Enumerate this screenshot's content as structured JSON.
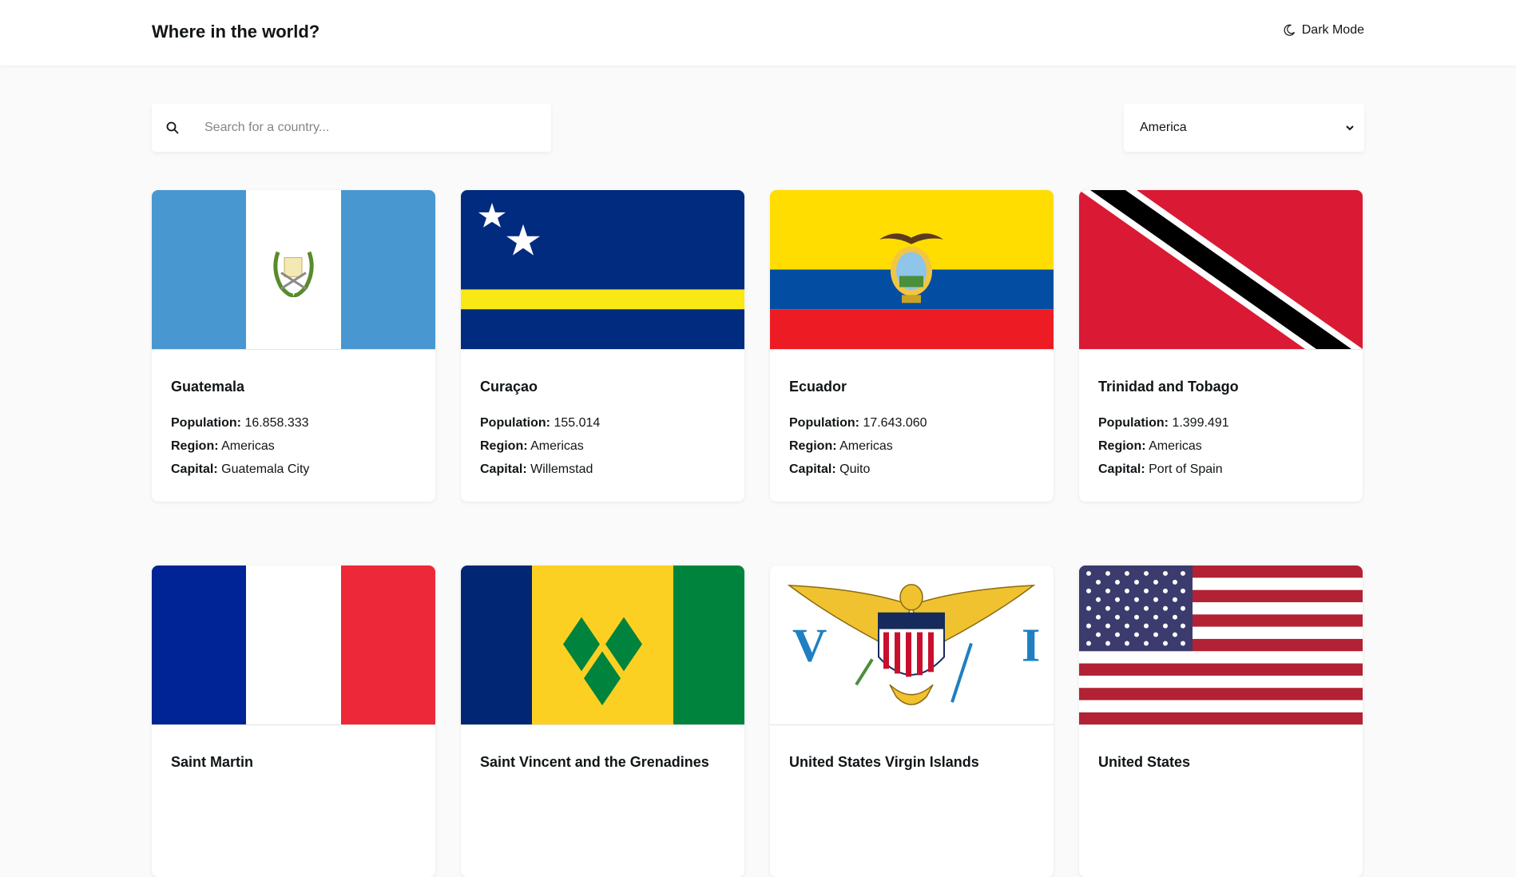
{
  "header": {
    "title": "Where in the world?",
    "theme_label": "Dark Mode"
  },
  "search": {
    "placeholder": "Search for a country..."
  },
  "filter": {
    "selected": "America"
  },
  "labels": {
    "population": "Population:",
    "region": "Region:",
    "capital": "Capital:"
  },
  "countries": [
    {
      "name": "Guatemala",
      "population": "16.858.333",
      "region": "Americas",
      "capital": "Guatemala City"
    },
    {
      "name": "Curaçao",
      "population": "155.014",
      "region": "Americas",
      "capital": "Willemstad"
    },
    {
      "name": "Ecuador",
      "population": "17.643.060",
      "region": "Americas",
      "capital": "Quito"
    },
    {
      "name": "Trinidad and Tobago",
      "population": "1.399.491",
      "region": "Americas",
      "capital": "Port of Spain"
    },
    {
      "name": "Saint Martin",
      "population": "",
      "region": "",
      "capital": ""
    },
    {
      "name": "Saint Vincent and the Grenadines",
      "population": "",
      "region": "",
      "capital": ""
    },
    {
      "name": "United States Virgin Islands",
      "population": "",
      "region": "",
      "capital": ""
    },
    {
      "name": "United States",
      "population": "",
      "region": "",
      "capital": ""
    }
  ],
  "colors": {
    "background": "#fafafa",
    "card": "#ffffff",
    "text": "#111517",
    "placeholder": "#858585"
  }
}
